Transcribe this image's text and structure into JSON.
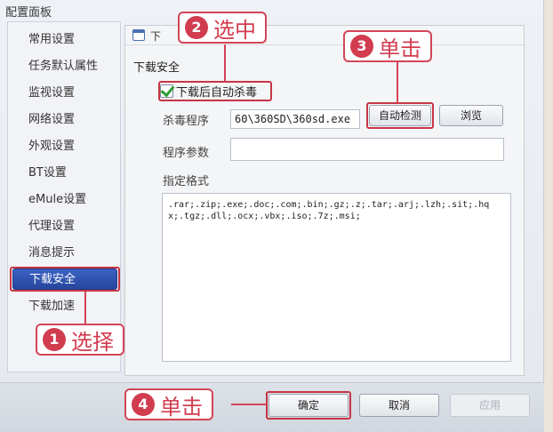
{
  "window": {
    "title": "配置面板"
  },
  "sidebar": {
    "items": [
      {
        "label": "常用设置"
      },
      {
        "label": "任务默认属性"
      },
      {
        "label": "监视设置"
      },
      {
        "label": "网络设置"
      },
      {
        "label": "外观设置"
      },
      {
        "label": "BT设置"
      },
      {
        "label": "eMule设置"
      },
      {
        "label": "代理设置"
      },
      {
        "label": "消息提示"
      },
      {
        "label": "下载安全",
        "active": true
      },
      {
        "label": "下载加速"
      }
    ]
  },
  "panel": {
    "header_text": "下",
    "section_title": "下载安全",
    "checkbox_label": "下载后自动杀毒",
    "checkbox_checked": true,
    "antivirus_label": "杀毒程序",
    "antivirus_value": "60\\360SD\\360sd.exe",
    "auto_detect_label": "自动检测",
    "browse_label": "浏览",
    "params_label": "程序参数",
    "params_value": "",
    "formats_label": "指定格式",
    "formats_value": ".rar;.zip;.exe;.doc;.com;.bin;.gz;.z;.tar;.arj;.lzh;.sit;.hqx;.tgz;.dll;.ocx;.vbx;.iso;.7z;.msi;"
  },
  "footer": {
    "ok_label": "确定",
    "cancel_label": "取消",
    "apply_label": "应用"
  },
  "annotations": {
    "step1": {
      "num": "1",
      "text": "选择"
    },
    "step2": {
      "num": "2",
      "text": "选中"
    },
    "step3": {
      "num": "3",
      "text": "单击"
    },
    "step4": {
      "num": "4",
      "text": "单击"
    },
    "color": "#d23c4f"
  }
}
